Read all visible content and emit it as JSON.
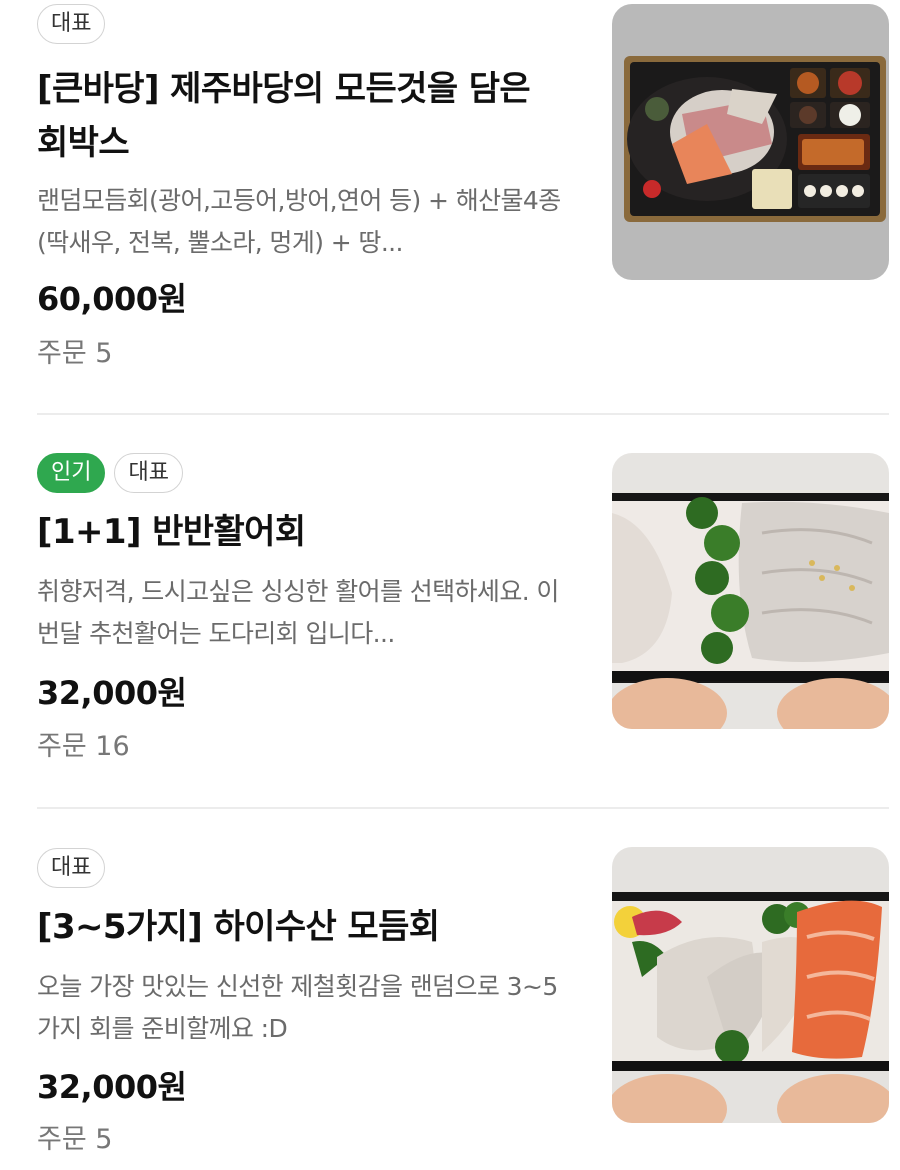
{
  "menu": {
    "items": [
      {
        "badges": [
          {
            "label": "대표",
            "kind": "representative"
          }
        ],
        "title": "[큰바당] 제주바당의 모든것을 담은 회박스",
        "description": "랜덤모듬회(광어,고등어,방어,연어 등) + 해산물4종(딱새우, 전복, 뿔소라, 멍게) + 땅...",
        "price": "60,000원",
        "orders": "주문 5"
      },
      {
        "badges": [
          {
            "label": "인기",
            "kind": "popular"
          },
          {
            "label": "대표",
            "kind": "representative"
          }
        ],
        "title": "[1+1] 반반활어회",
        "description": "취향저격, 드시고싶은 싱싱한 활어를 선택하세요. 이번달 추천활어는 도다리회 입니다...",
        "price": "32,000원",
        "orders": "주문 16"
      },
      {
        "badges": [
          {
            "label": "대표",
            "kind": "representative"
          }
        ],
        "title": "[3~5가지] 하이수산 모듬회",
        "description": "오늘 가장 맛있는 신선한 제철횟감을 랜덤으로 3~5가지 회를 준비할께요 :D",
        "price": "32,000원",
        "orders": "주문 5"
      }
    ]
  },
  "colors": {
    "popular_badge": "#2fa84f",
    "price_text": "#111111",
    "muted_text": "#6b6b6b",
    "divider": "#ececec"
  }
}
